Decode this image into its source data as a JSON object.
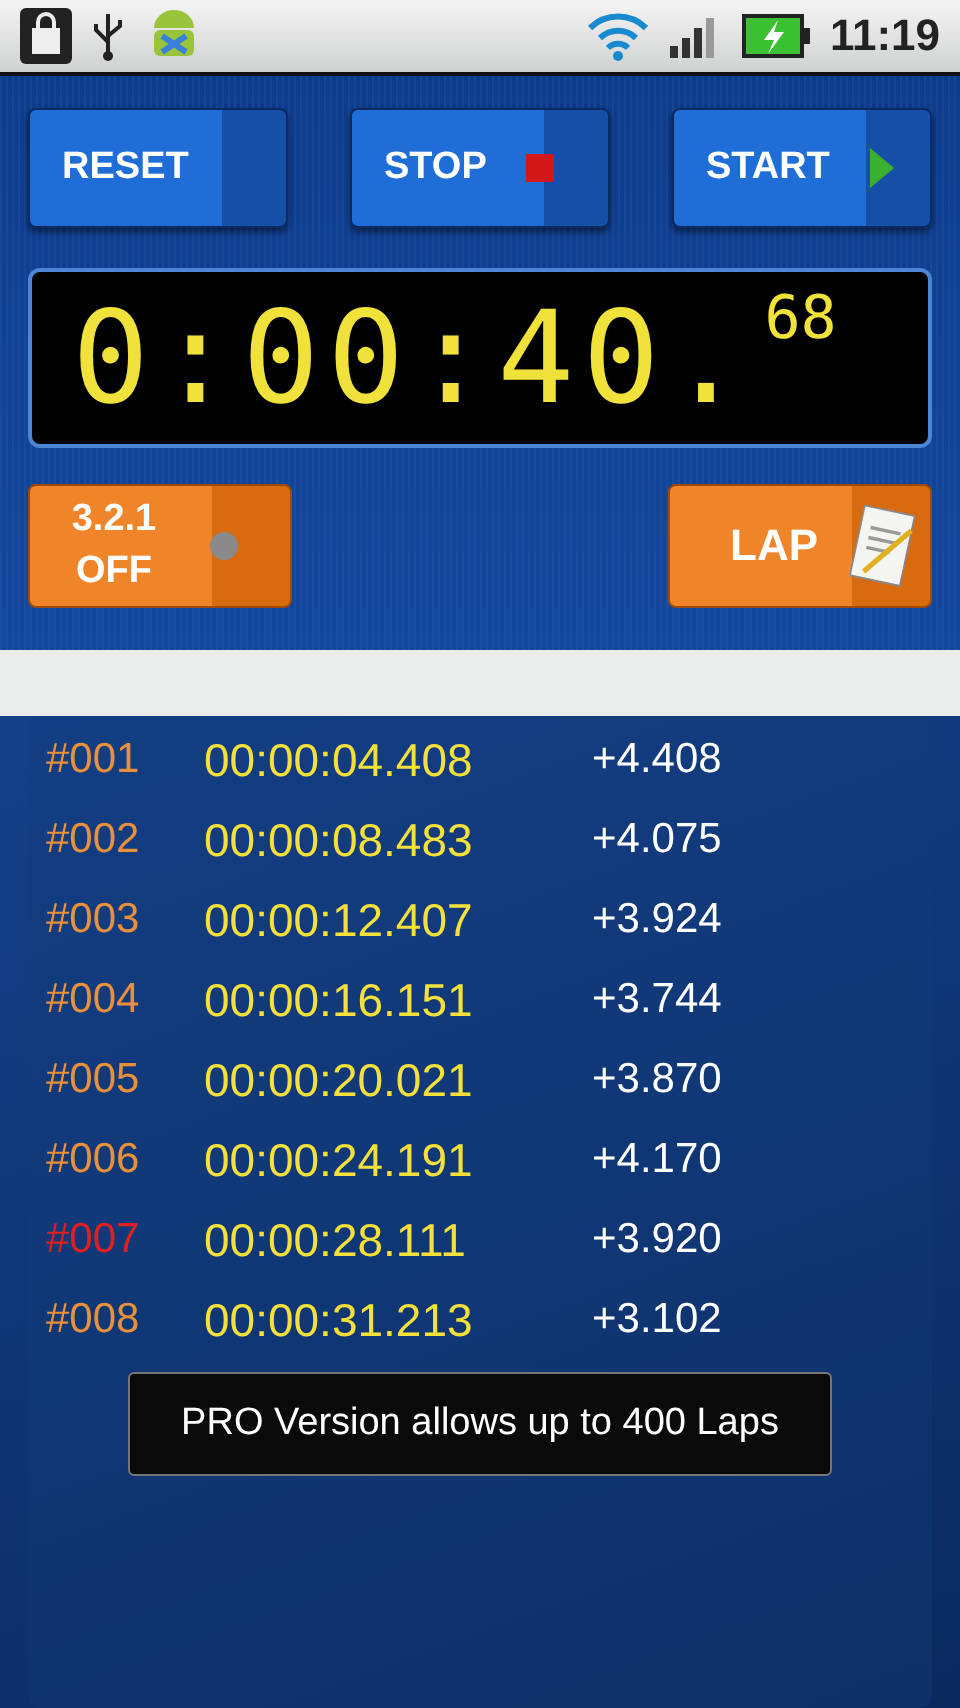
{
  "status_bar": {
    "time": "11:19"
  },
  "controls": {
    "buttons": [
      {
        "label": "RESET",
        "kind": "plain"
      },
      {
        "label": "STOP",
        "kind": "stop"
      },
      {
        "label": "START",
        "kind": "start"
      }
    ]
  },
  "display": {
    "time": "0:00:40.",
    "fraction": "68"
  },
  "countdown": {
    "label": "3.2.1",
    "state": "OFF",
    "on": false
  },
  "lap_button": {
    "label": "LAP"
  },
  "laps": [
    {
      "number": "#001",
      "time": "00:00:04.408",
      "split": "+4.408",
      "color": "#e8903a"
    },
    {
      "number": "#002",
      "time": "00:00:08.483",
      "split": "+4.075",
      "color": "#e8903a"
    },
    {
      "number": "#003",
      "time": "00:00:12.407",
      "split": "+3.924",
      "color": "#e8903a"
    },
    {
      "number": "#004",
      "time": "00:00:16.151",
      "split": "+3.744",
      "color": "#e8903a"
    },
    {
      "number": "#005",
      "time": "00:00:20.021",
      "split": "+3.870",
      "color": "#e8903a"
    },
    {
      "number": "#006",
      "time": "00:00:24.191",
      "split": "+4.170",
      "color": "#e8903a"
    },
    {
      "number": "#007",
      "time": "00:00:28.111",
      "split": "+3.920",
      "color": "#e02020"
    },
    {
      "number": "#008",
      "time": "00:00:31.213",
      "split": "+3.102",
      "color": "#e8903a"
    }
  ],
  "toast": "PRO Version allows up to 400 Laps"
}
